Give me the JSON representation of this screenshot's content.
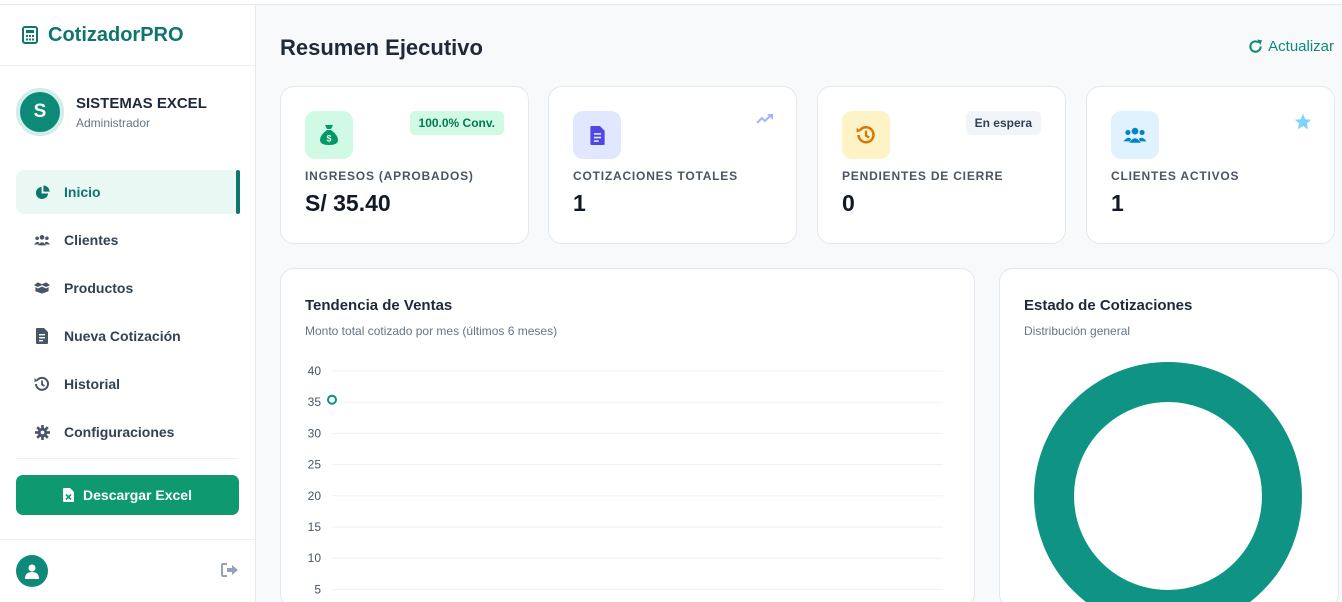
{
  "brand": {
    "name": "CotizadorPRO",
    "icon": "calculator-icon"
  },
  "user": {
    "initial": "S",
    "name": "SISTEMAS EXCEL",
    "role": "Administrador"
  },
  "nav": [
    {
      "label": "Inicio",
      "icon": "chart-pie-icon",
      "active": true
    },
    {
      "label": "Clientes",
      "icon": "users-icon"
    },
    {
      "label": "Productos",
      "icon": "boxes-icon"
    },
    {
      "label": "Nueva Cotización",
      "icon": "file-invoice-icon"
    },
    {
      "label": "Historial",
      "icon": "history-icon"
    },
    {
      "label": "Configuraciones",
      "icon": "gear-icon"
    }
  ],
  "excel_button": {
    "label": "Descargar Excel",
    "icon": "file-excel-icon"
  },
  "header": {
    "title": "Resumen Ejecutivo",
    "refresh_label": "Actualizar"
  },
  "cards": [
    {
      "label": "INGRESOS (APROBADOS)",
      "value": "S/ 35.40",
      "badge": "100.0% Conv.",
      "icon": "money-bag-icon",
      "icon_bg": "#d1fae5",
      "icon_color": "#059669"
    },
    {
      "label": "COTIZACIONES TOTALES",
      "value": "1",
      "icon": "file-invoice-icon",
      "corner_icon": "trend-up-icon",
      "icon_bg": "#e0e7ff",
      "icon_color": "#4f46e5"
    },
    {
      "label": "PENDIENTES DE CIERRE",
      "value": "0",
      "badge": "En espera",
      "icon": "history-icon",
      "icon_bg": "#fef3c7",
      "icon_color": "#d97706"
    },
    {
      "label": "CLIENTES ACTIVOS",
      "value": "1",
      "icon": "users-icon",
      "corner_icon": "star-icon",
      "icon_bg": "#e0f2fe",
      "icon_color": "#0284c7"
    }
  ],
  "sales_chart": {
    "title": "Tendencia de Ventas",
    "subtitle": "Monto total cotizado por mes (últimos 6 meses)"
  },
  "status_chart": {
    "title": "Estado de Cotizaciones",
    "subtitle": "Distribución general"
  },
  "chart_data": [
    {
      "type": "line",
      "yticks": [
        40,
        35,
        30,
        25,
        20,
        15,
        10,
        5
      ],
      "ylim": [
        0,
        40
      ],
      "values": [
        35.4
      ],
      "grid": true
    },
    {
      "type": "pie",
      "values": [
        100
      ],
      "colors": [
        "#0f9384"
      ]
    }
  ],
  "colors": {
    "accent": "#0f766e",
    "excel": "#0e9a6e",
    "donut": "#0f9384"
  }
}
